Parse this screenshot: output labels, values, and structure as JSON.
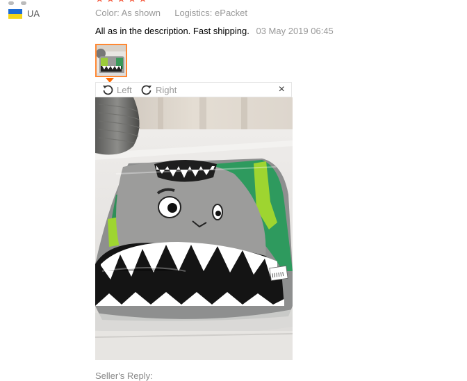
{
  "review": {
    "stars": [
      "★",
      "★",
      "★",
      "★",
      "★"
    ],
    "country": "UA",
    "color_label": "Color:",
    "color_value": "As shown",
    "logistics_label": "Logistics:",
    "logistics_value": "ePacket",
    "text": "All as in the description. Fast shipping.",
    "date": "03 May 2019 06:45"
  },
  "viewer": {
    "rotate_left": "Left",
    "rotate_right": "Right",
    "close": "×"
  },
  "footer_partial": "Seller's Reply:",
  "colors": {
    "accent_orange": "#ff8833",
    "star_color": "#f55b3f",
    "muted_text": "#999999"
  }
}
